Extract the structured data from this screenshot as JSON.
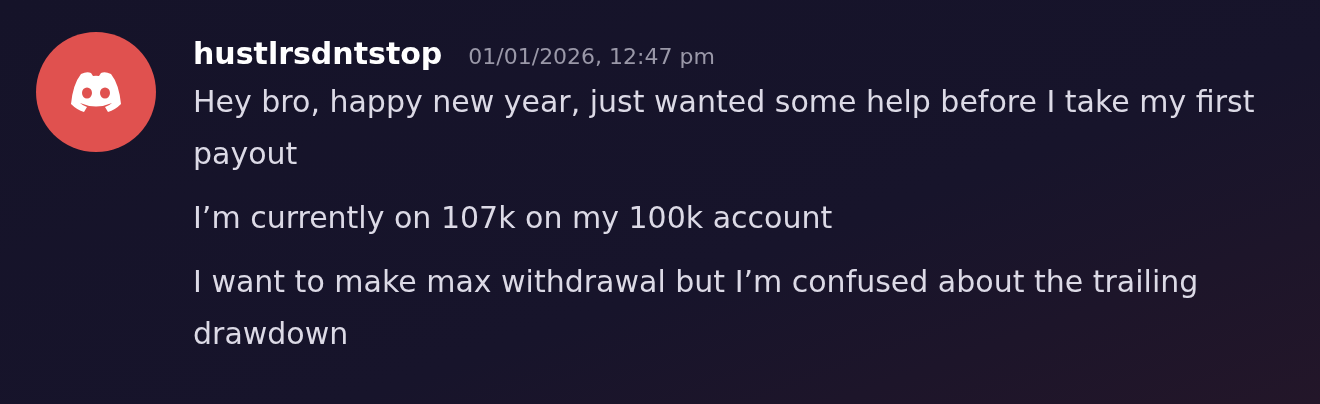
{
  "message": {
    "author": "hustlrsdntstop",
    "timestamp": "01/01/2026, 12:47 pm",
    "lines": [
      "Hey bro, happy new year, just wanted some help before I take my first payout",
      "I’m currently on 107k on my 100k account",
      "I want to make max withdrawal but I’m confused about the trailing drawdown"
    ]
  }
}
